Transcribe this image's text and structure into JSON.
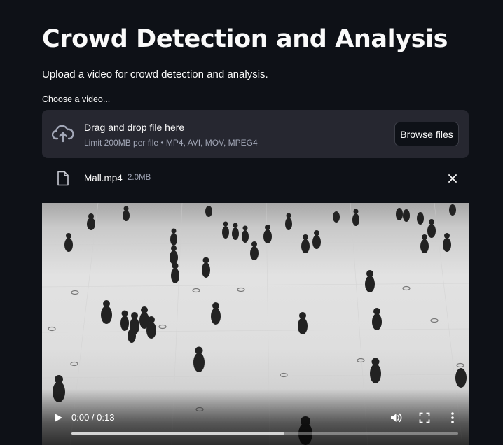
{
  "page": {
    "title": "Crowd Detection and Analysis",
    "subtitle": "Upload a video for crowd detection and analysis."
  },
  "uploader": {
    "label": "Choose a video...",
    "dropzone_title": "Drag and drop file here",
    "dropzone_hint": "Limit 200MB per file • MP4, AVI, MOV, MPEG4",
    "browse_label": "Browse files",
    "icon": "cloud-upload-icon"
  },
  "file": {
    "name": "Mall.mp4",
    "size": "2.0MB",
    "icon": "file-icon",
    "remove_icon": "close-icon"
  },
  "video": {
    "current_time": "0:00",
    "duration": "0:13",
    "time_display": "0:00 / 0:13",
    "progress": 0.0,
    "buffered": 0.55,
    "icons": [
      "play-icon",
      "volume-icon",
      "fullscreen-icon",
      "more-vert-icon"
    ]
  },
  "colors": {
    "background": "#0e1117",
    "dropzone": "#262730",
    "text": "#fafafa",
    "muted": "#a3a8b8"
  }
}
